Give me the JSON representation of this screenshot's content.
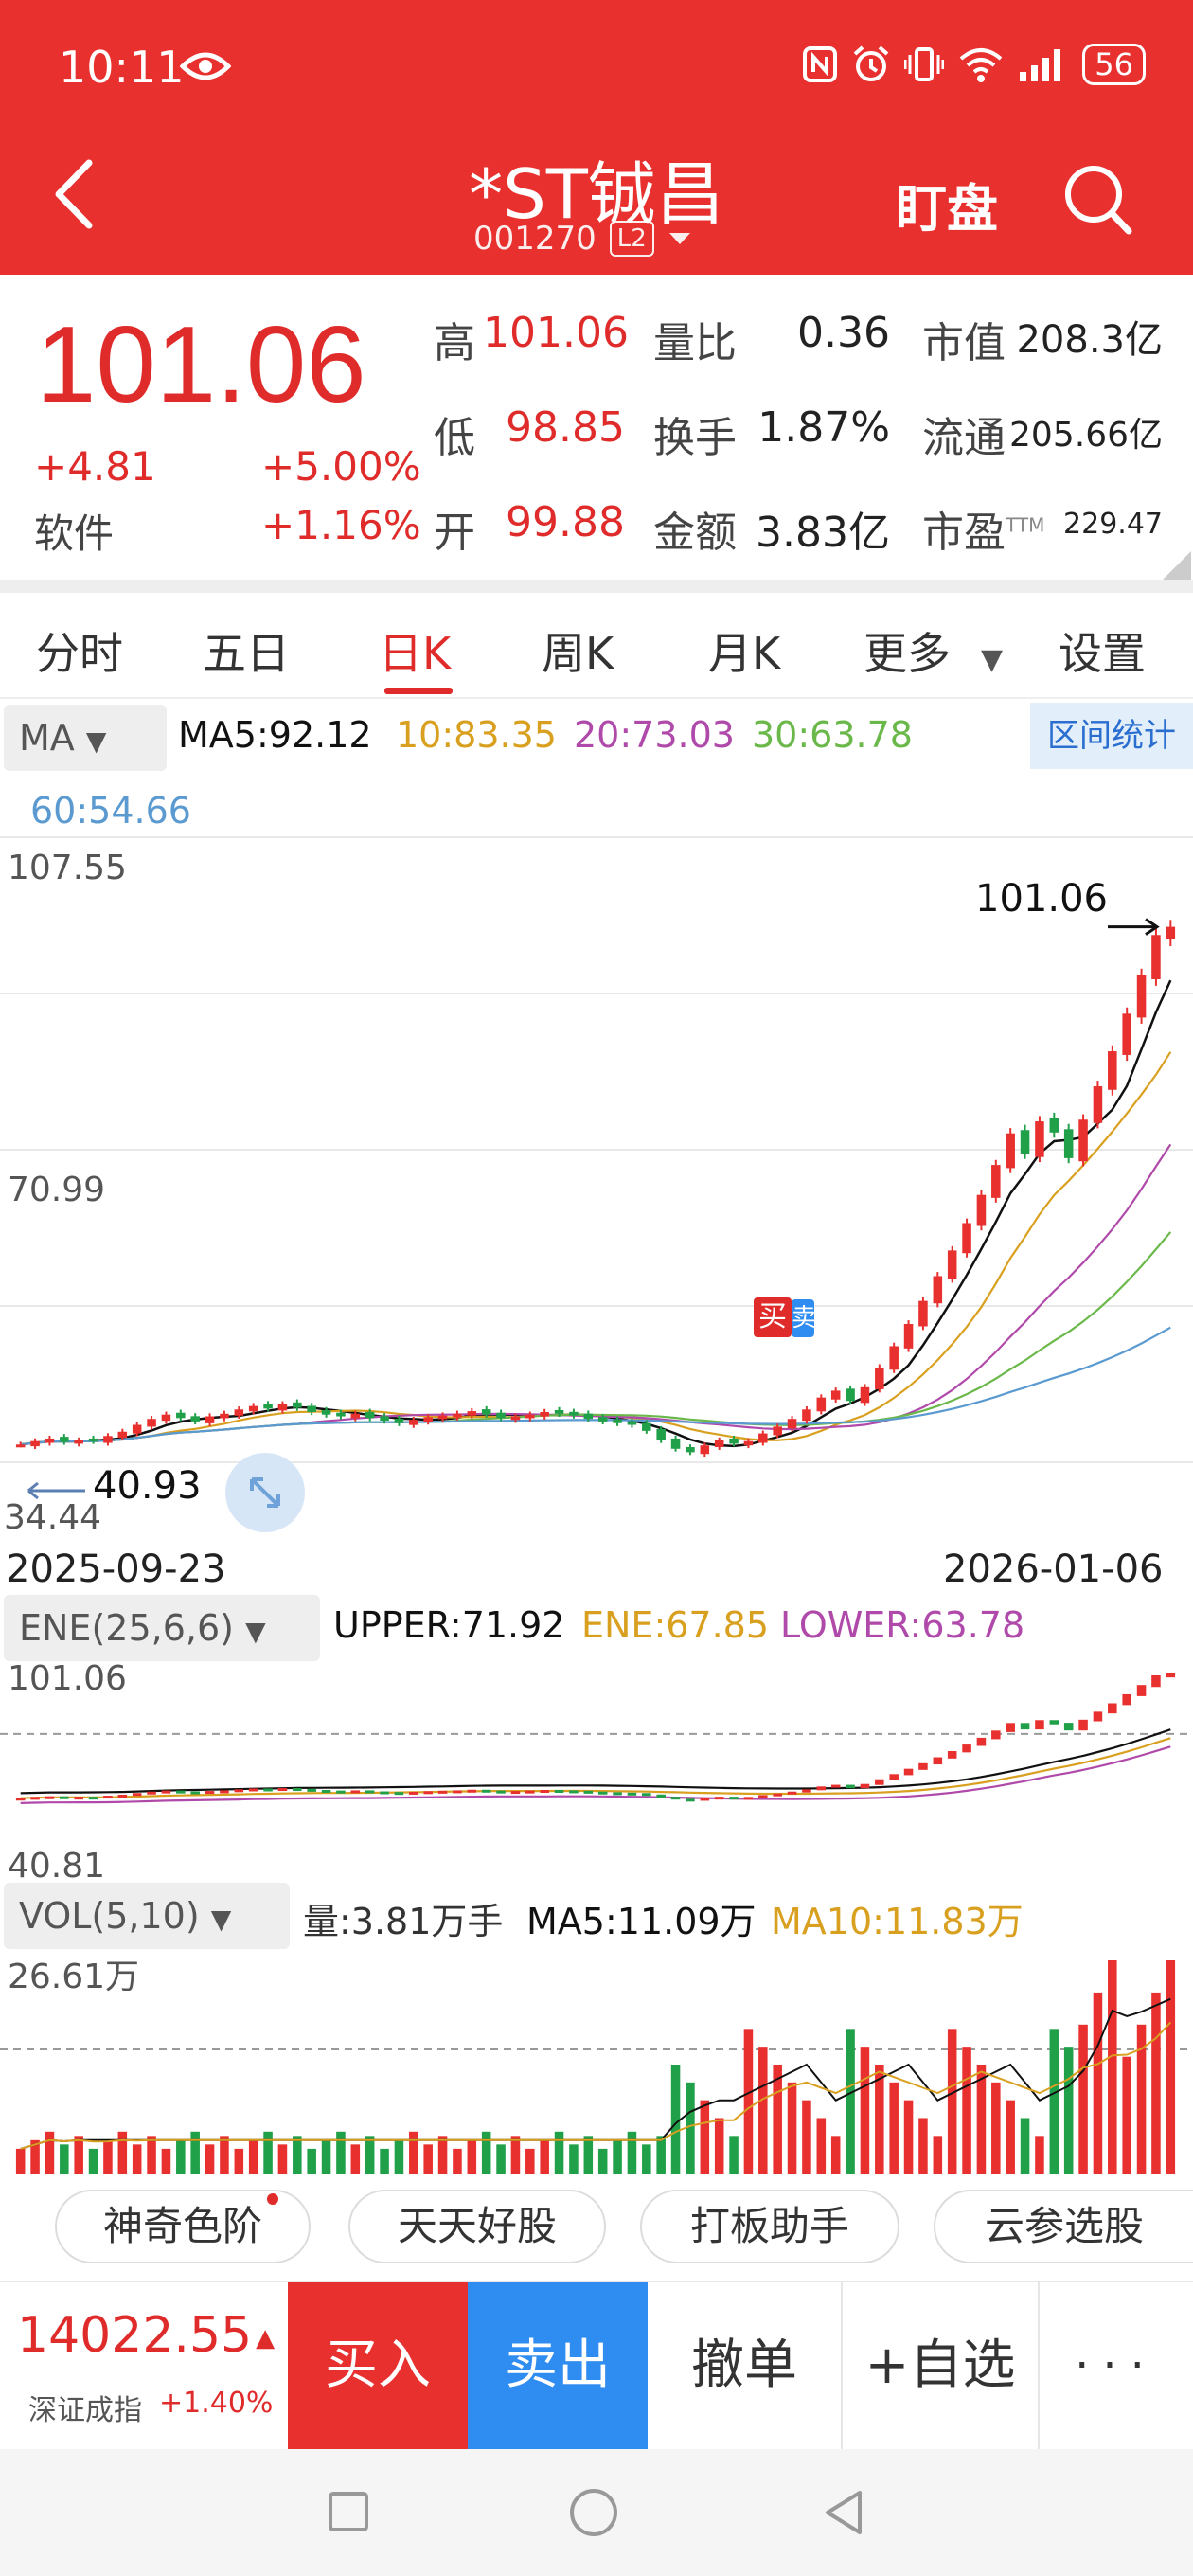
{
  "status_bar": {
    "time": "10:11",
    "battery": "56"
  },
  "header": {
    "title": "*ST铖昌",
    "code": "001270",
    "level_badge": "L2",
    "watch_label": "盯盘"
  },
  "quote": {
    "price": "101.06",
    "change": "+4.81",
    "change_pct": "+5.00%",
    "sector": "软件",
    "sector_pct": "+1.16%",
    "high_label": "高",
    "high": "101.06",
    "low_label": "低",
    "low": "98.85",
    "open_label": "开",
    "open": "99.88",
    "vol_ratio_label": "量比",
    "vol_ratio": "0.36",
    "turnover_label": "换手",
    "turnover": "1.87%",
    "amount_label": "金额",
    "amount": "3.83亿",
    "mktcap_label": "市值",
    "mktcap": "208.3亿",
    "float_label": "流通",
    "float": "205.66亿",
    "pe_label": "市盈",
    "pe_sup": "TTM",
    "pe": "229.47"
  },
  "tabs": [
    "分时",
    "五日",
    "日K",
    "周K",
    "月K",
    "更多",
    "设置"
  ],
  "active_tab": "日K",
  "ma_bar": {
    "selector": "MA",
    "ma5": "MA5:92.12",
    "ma10": "10:83.35",
    "ma20": "20:73.03",
    "ma30": "30:63.78",
    "ma60": "60:54.66",
    "range_button": "区间统计"
  },
  "main_axis": {
    "top": "107.55",
    "mid": "70.99",
    "bottom": "34.44",
    "last_price": "101.06",
    "low_marker": "40.93",
    "buy_marker": "买",
    "sell_marker": "卖"
  },
  "dates": {
    "start": "2025-09-23",
    "end": "2026-01-06"
  },
  "ene_bar": {
    "selector": "ENE(25,6,6)",
    "upper": "UPPER:71.92",
    "ene": "ENE:67.85",
    "lower": "LOWER:63.78",
    "top": "101.06",
    "bottom": "40.81"
  },
  "vol_bar": {
    "selector": "VOL(5,10)",
    "vol": "量:3.81万手",
    "ma5": "MA5:11.09万",
    "ma10": "MA10:11.83万",
    "top": "26.61万"
  },
  "tools": [
    "神奇色阶",
    "天天好股",
    "打板助手",
    "云参选股"
  ],
  "trade_bar": {
    "index_value": "14022.55",
    "index_name": "深证成指",
    "index_change": "+1.40%",
    "buy": "买入",
    "sell": "卖出",
    "cancel": "撤单",
    "add_watch": "+自选",
    "more": "···"
  },
  "colors": {
    "up": "#e8302f",
    "down": "#21a04a",
    "brand": "#e8302f",
    "sell": "#2f8cf0",
    "ma5": "#111111",
    "ma10": "#d9a020",
    "ma20": "#b04aaa",
    "ma30": "#6ab84a",
    "ma60": "#5a9ad0"
  },
  "chart_data": {
    "type": "candlestick",
    "x_range": [
      "2025-09-23",
      "2026-01-06"
    ],
    "y_range": [
      34.44,
      107.55
    ],
    "last_close": 101.06,
    "closes": [
      40.5,
      40.9,
      41.2,
      40.8,
      41.0,
      40.9,
      41.5,
      42.0,
      42.8,
      43.5,
      44.0,
      43.6,
      43.2,
      43.8,
      44.1,
      44.6,
      45.0,
      44.7,
      45.2,
      44.8,
      44.3,
      44.0,
      43.8,
      44.1,
      43.6,
      43.3,
      43.0,
      43.4,
      43.7,
      43.9,
      44.1,
      44.4,
      44.0,
      43.6,
      43.8,
      44.0,
      44.3,
      44.1,
      43.9,
      43.5,
      43.2,
      43.0,
      42.8,
      42.1,
      41.0,
      40.0,
      39.6,
      40.4,
      41.0,
      40.6,
      40.9,
      41.8,
      42.6,
      43.5,
      44.6,
      46.0,
      46.8,
      45.6,
      47.2,
      49.5,
      52.0,
      54.6,
      57.3,
      60.2,
      63.2,
      66.4,
      69.7,
      73.2,
      76.9,
      74.5,
      78.3,
      77.0,
      74.0,
      78.5,
      82.4,
      86.5,
      90.9,
      95.4,
      100.1,
      101.06
    ],
    "volume_max": "26.61万"
  }
}
